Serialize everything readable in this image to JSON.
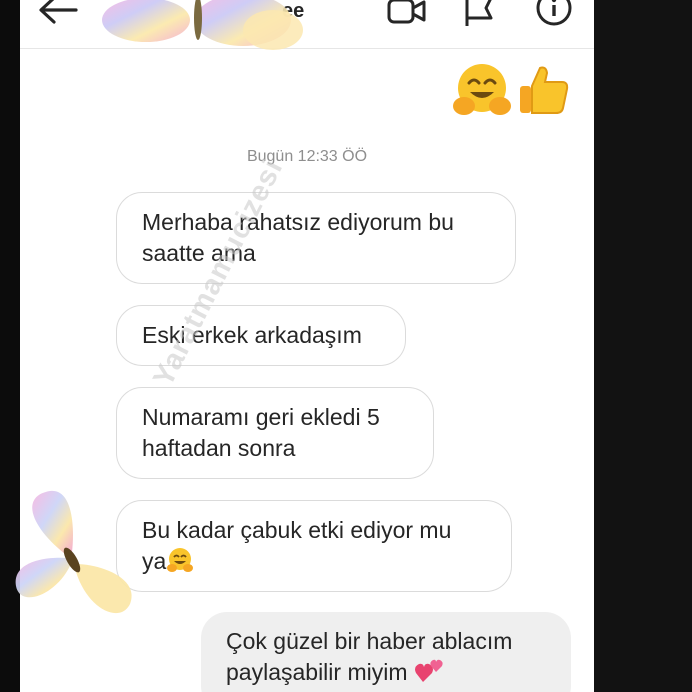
{
  "header": {
    "title": "ee",
    "back_icon": "back-arrow-icon",
    "icons": [
      "video-call-icon",
      "flag-icon",
      "info-icon"
    ]
  },
  "reactions": [
    "hugging-face-emoji",
    "thumbs-up-emoji"
  ],
  "timestamp": "Bugün 12:33 ÖÖ",
  "messages": [
    {
      "direction": "incoming",
      "lines": [
        "Merhaba rahatsız ediyorum bu",
        "saatte ama"
      ]
    },
    {
      "direction": "incoming",
      "lines": [
        "Eski erkek arkadaşım"
      ]
    },
    {
      "direction": "incoming",
      "lines": [
        "Numaramı geri ekledi 5",
        "haftadan sonra"
      ]
    },
    {
      "direction": "incoming",
      "lines": [
        "Bu kadar çabuk etki ediyor mu",
        "ya"
      ],
      "emoji": "hugging-face-emoji"
    },
    {
      "direction": "outgoing",
      "lines": [
        "Çok güzel bir haber ablacım",
        "paylaşabilir miyim"
      ],
      "emoji": "two-hearts-emoji"
    }
  ],
  "watermark": "Yaratmamucizesi",
  "colors": {
    "background": "#ffffff",
    "incoming_border": "#dbdbdb",
    "outgoing_bubble": "#efefef",
    "text": "#262626",
    "timestamp": "#8e8e8e"
  }
}
